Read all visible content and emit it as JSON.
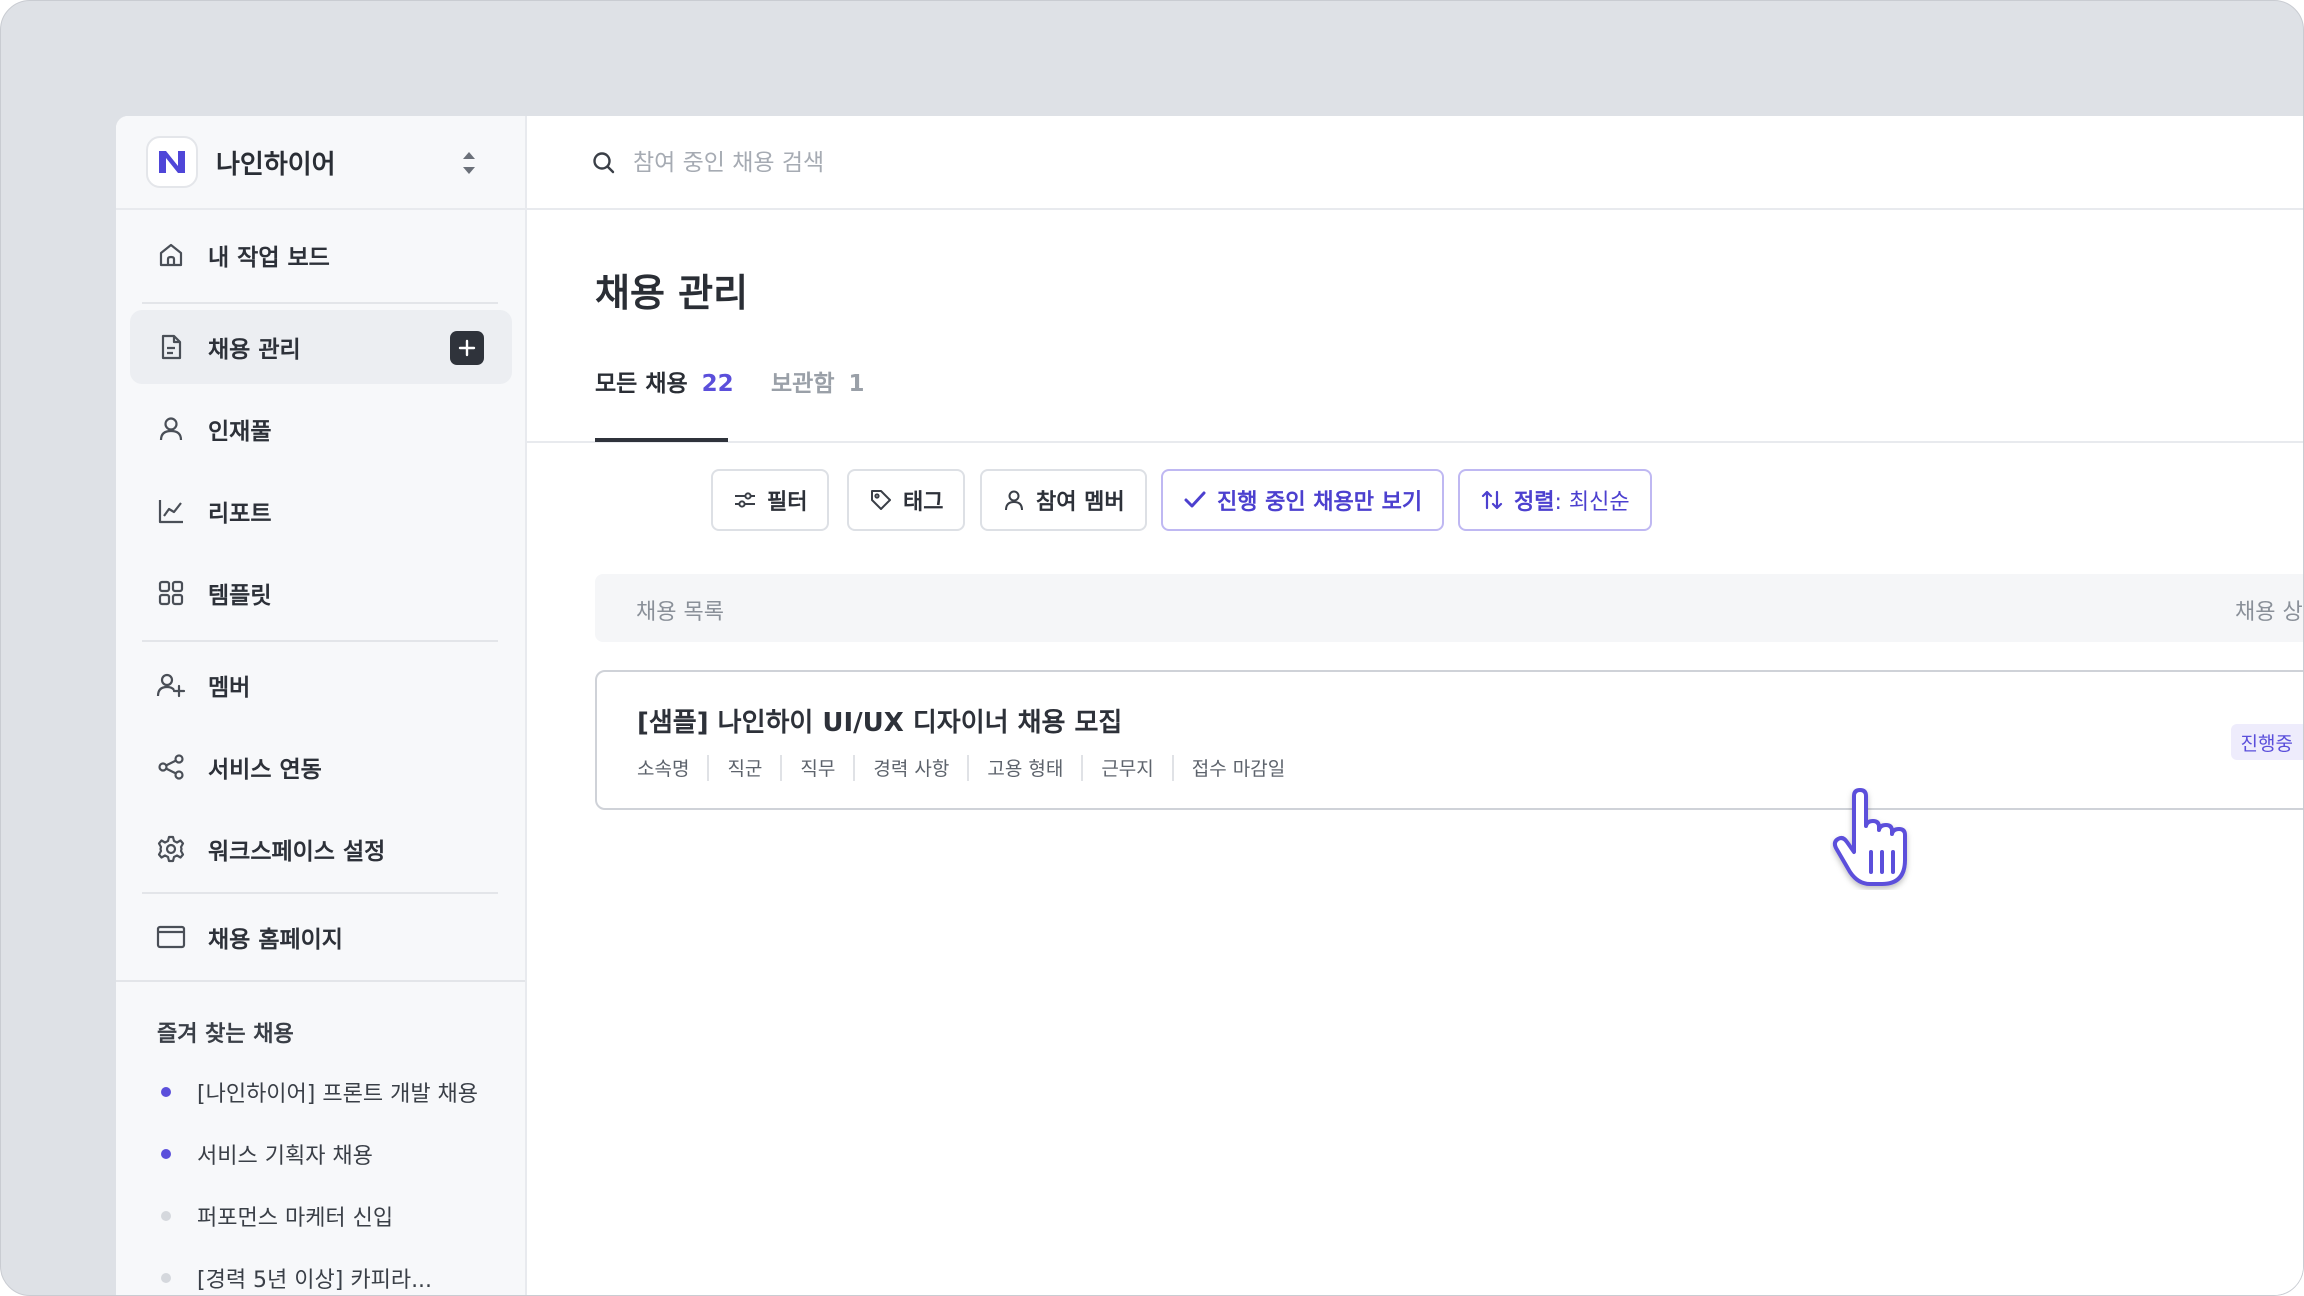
{
  "workspace": {
    "name": "나인하이어"
  },
  "sidebar": {
    "items": [
      {
        "label": "내 작업 보드",
        "icon": "home-icon"
      },
      {
        "label": "채용 관리",
        "icon": "document-icon"
      },
      {
        "label": "인재풀",
        "icon": "person-icon"
      },
      {
        "label": "리포트",
        "icon": "chart-line-icon"
      },
      {
        "label": "템플릿",
        "icon": "grid-icon"
      },
      {
        "label": "멤버",
        "icon": "user-plus-icon"
      },
      {
        "label": "서비스 연동",
        "icon": "share-icon"
      },
      {
        "label": "워크스페이스 설정",
        "icon": "gear-icon"
      },
      {
        "label": "채용 홈페이지",
        "icon": "browser-window-icon"
      }
    ],
    "favorites_title": "즐겨 찾는 채용",
    "favorites": [
      {
        "label": "[나인하이어] 프론트 개발 채용",
        "dot_color": "#5b4fdb"
      },
      {
        "label": "서비스 기획자 채용",
        "dot_color": "#5b4fdb"
      },
      {
        "label": "퍼포먼스 마케터 신입",
        "dot_color": "#d5d8dd"
      },
      {
        "label": "[경력 5년 이상] 카피라...",
        "dot_color": "#d5d8dd"
      }
    ]
  },
  "search": {
    "placeholder": "참여 중인 채용 검색"
  },
  "page": {
    "title": "채용 관리"
  },
  "tabs": [
    {
      "label": "모든 채용",
      "count": "22"
    },
    {
      "label": "보관함",
      "count": "1"
    }
  ],
  "toolbar": {
    "filter": "필터",
    "tag": "태그",
    "members": "참여 멤버",
    "active_only": "진행 중인 채용만 보기",
    "sort_label": "정렬",
    "sort_value": " : 최신순"
  },
  "list": {
    "header_left": "채용 목록",
    "header_right": "채용 상태",
    "jobs": [
      {
        "title": "[샘플] 나인하이 UI/UX 디자이너 채용 모집",
        "meta": [
          "소속명",
          "직군",
          "직무",
          "경력 사항",
          "고용 형태",
          "근무지",
          "접수 마감일"
        ],
        "status": "진행중"
      }
    ]
  },
  "colors": {
    "accent": "#5b4fdb",
    "dark": "#2f333b",
    "frame": "#dee1e6"
  }
}
